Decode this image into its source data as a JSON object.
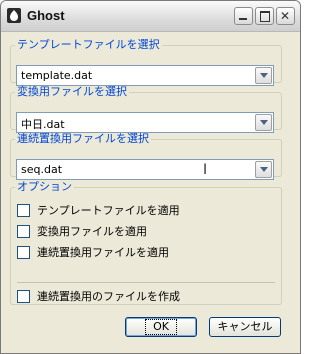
{
  "window": {
    "title": "Ghost"
  },
  "groups": {
    "template": {
      "label": "テンプレートファイルを選択",
      "value": "template.dat"
    },
    "conversion": {
      "label": "変換用ファイルを選択",
      "value": "中日.dat"
    },
    "sequential": {
      "label": "連続置換用ファイルを選択",
      "value": "seq.dat"
    }
  },
  "options": {
    "label": "オプション",
    "items": [
      {
        "label": "テンプレートファイルを適用",
        "checked": false
      },
      {
        "label": "変換用ファイルを適用",
        "checked": false
      },
      {
        "label": "連続置換用ファイルを適用",
        "checked": false
      },
      {
        "label": "連続置換用のファイルを作成",
        "checked": false
      }
    ]
  },
  "buttons": {
    "ok": "OK",
    "cancel": "キャンセル"
  },
  "colors": {
    "group_label": "#0046d5",
    "dialog_bg": "#ece9d8",
    "field_border": "#7f9db9"
  },
  "icons": [
    "app-icon",
    "minimize-icon",
    "maximize-icon",
    "close-icon",
    "dropdown-arrow-icon",
    "text-cursor-icon"
  ]
}
